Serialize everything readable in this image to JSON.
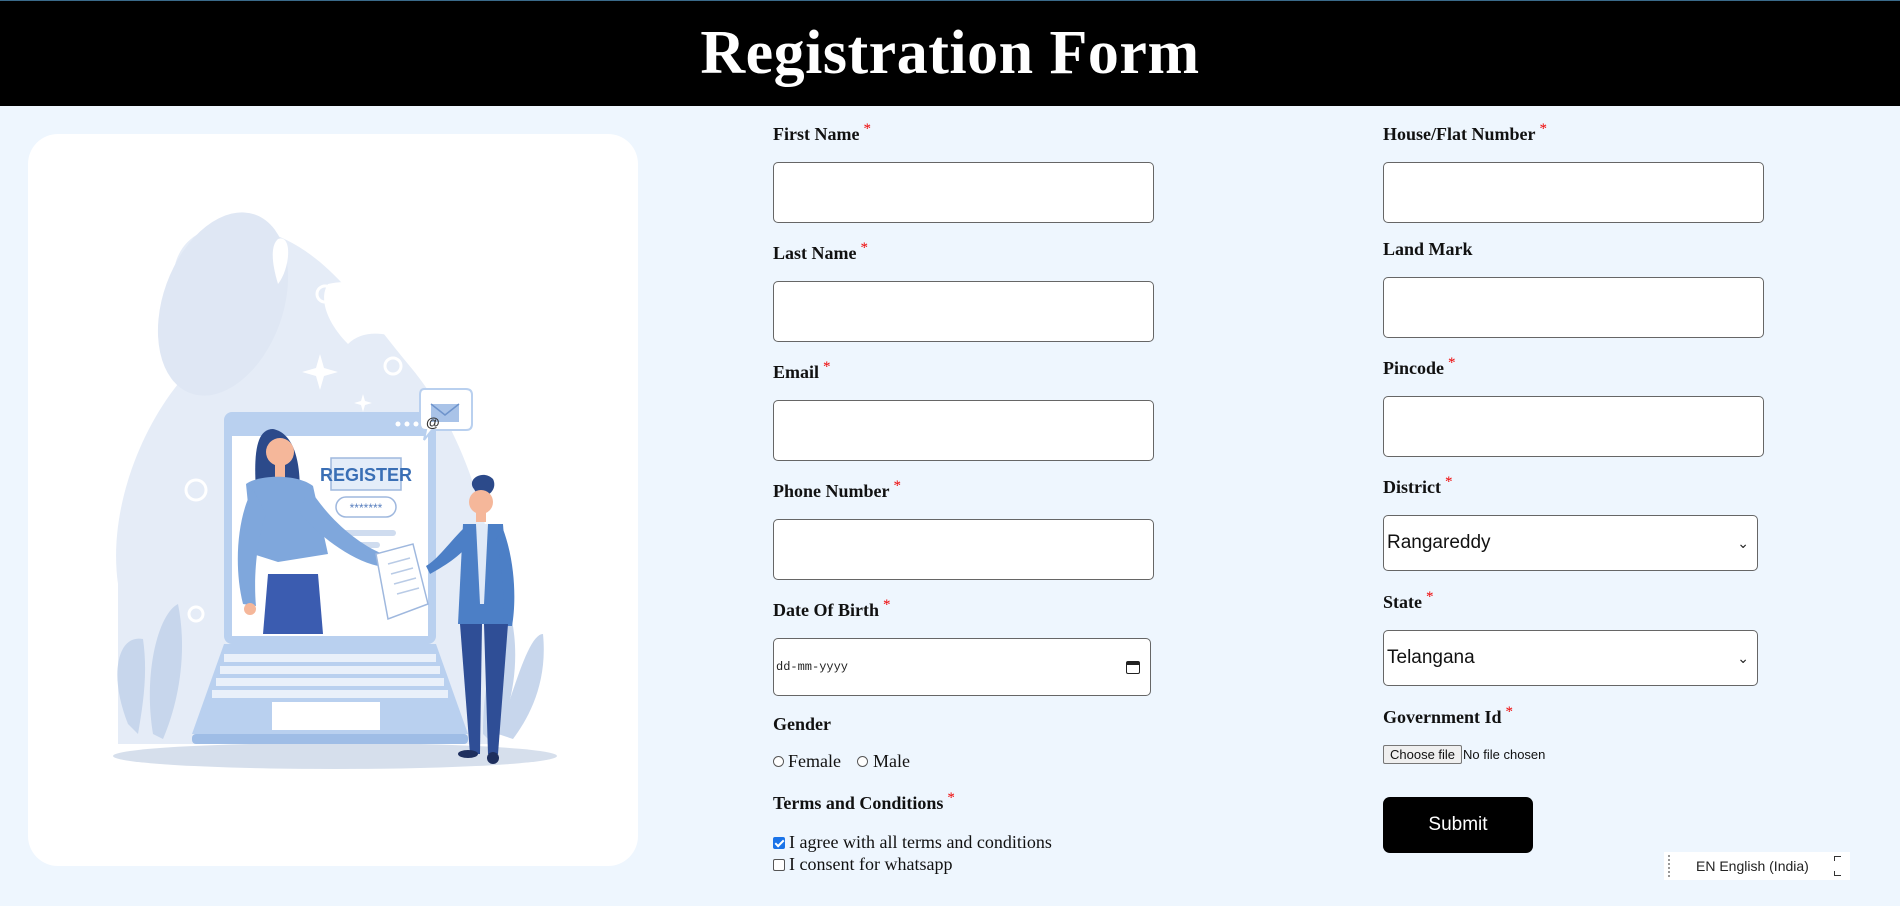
{
  "header": {
    "title": "Registration Form"
  },
  "form": {
    "first_name": {
      "label": "First Name",
      "required": "*",
      "value": ""
    },
    "last_name": {
      "label": "Last Name",
      "required": "*",
      "value": ""
    },
    "email": {
      "label": "Email",
      "required": "*",
      "value": ""
    },
    "phone": {
      "label": "Phone Number",
      "required": "*",
      "value": ""
    },
    "dob": {
      "label": "Date Of Birth",
      "required": "*",
      "placeholder": "dd-mm-yyyy"
    },
    "gender": {
      "label": "Gender",
      "options": [
        "Female",
        "Male"
      ],
      "selected": null
    },
    "terms": {
      "label": "Terms and Conditions",
      "required": "*",
      "options": [
        {
          "label": "I agree with all terms and conditions",
          "checked": true
        },
        {
          "label": "I consent for whatsapp",
          "checked": false
        }
      ]
    },
    "house": {
      "label": "House/Flat Number",
      "required": "*",
      "value": ""
    },
    "landmark": {
      "label": "Land Mark",
      "value": ""
    },
    "pincode": {
      "label": "Pincode",
      "required": "*",
      "value": ""
    },
    "district": {
      "label": "District",
      "required": "*",
      "selected": "Rangareddy"
    },
    "state": {
      "label": "State",
      "required": "*",
      "selected": "Telangana"
    },
    "gov_id": {
      "label": "Government Id",
      "required": "*",
      "button_label": "Choose file",
      "status": "No file chosen"
    },
    "submit_label": "Submit"
  },
  "illustration": {
    "badge_text": "REGISTER",
    "password_mask": "*******",
    "email_symbol": "@"
  },
  "language_bar": {
    "label": "EN English (India)"
  },
  "colors": {
    "header_bg": "#000000",
    "page_bg": "#eef6fe",
    "required": "#ee0000",
    "accent": "#1a73e8"
  }
}
